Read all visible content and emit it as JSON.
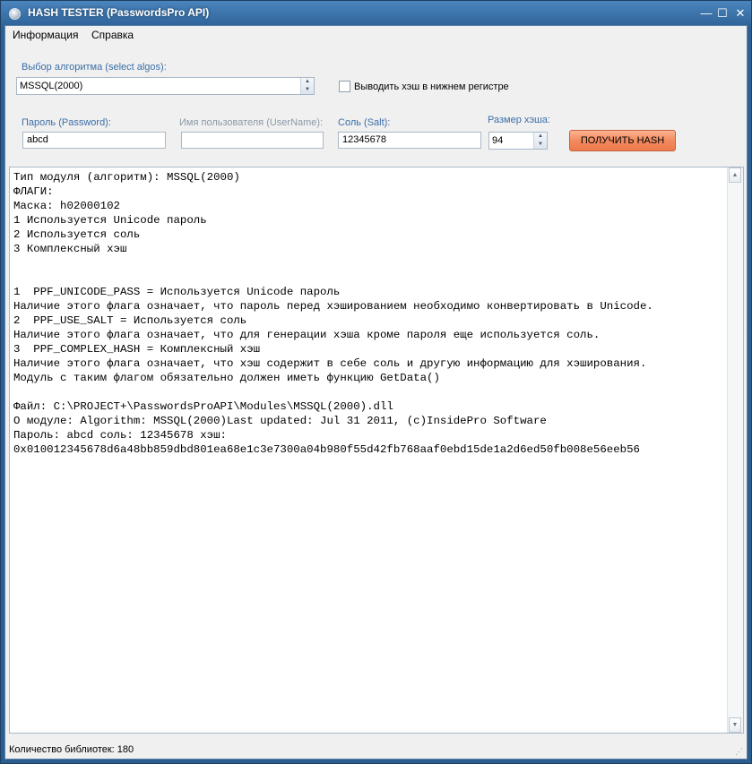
{
  "window": {
    "title": "HASH TESTER (PasswordsPro API)",
    "minimize": "—",
    "maximize": "☐",
    "close": "✕"
  },
  "menu": [
    "Информация",
    "Справка"
  ],
  "algo": {
    "label": "Выбор алгоритма (select algos):",
    "value": "MSSQL(2000)"
  },
  "lowercase": {
    "label": "Выводить хэш в нижнем регистре",
    "checked": false
  },
  "fields": {
    "password": {
      "label": "Пароль (Password):",
      "value": "abcd"
    },
    "username": {
      "label": "Имя пользователя (UserName):",
      "value": ""
    },
    "salt": {
      "label": "Соль (Salt):",
      "value": "12345678"
    },
    "hash_size": {
      "label": "Размер хэша:",
      "value": "94"
    }
  },
  "get_hash_button": "ПОЛУЧИТЬ HASH",
  "output_lines": [
    "Тип модуля (алгоритм): MSSQL(2000)",
    "ФЛАГИ:",
    "Маска: h02000102",
    "1 Используется Unicode пароль",
    "2 Используется соль",
    "3 Комплексный хэш",
    "",
    "",
    "1  PPF_UNICODE_PASS = Используется Unicode пароль",
    "Наличие этого флага означает, что пароль перед хэшированием необходимо конвертировать в Unicode.",
    "2  PPF_USE_SALT = Используется соль",
    "Наличие этого флага означает, что для генерации хэша кроме пароля еще используется соль.",
    "3  PPF_COMPLEX_HASH = Комплексный хэш",
    "Наличие этого флага означает, что хэш содержит в себе соль и другую информацию для хэширования.",
    "Модуль с таким флагом обязательно должен иметь функцию GetData()",
    "",
    "Файл: C:\\PROJECT+\\PasswordsProAPI\\Modules\\MSSQL(2000).dll",
    "О модуле: Algorithm: MSSQL(2000)Last updated: Jul 31 2011, (c)InsidePro Software",
    "Пароль: abcd соль: 12345678 хэш:",
    "0x010012345678d6a48bb859dbd801ea68e1c3e7300a04b980f55d42fb768aaf0ebd15de1a2d6ed50fb008e56eeb56"
  ],
  "status": "Количество библиотек: 180"
}
